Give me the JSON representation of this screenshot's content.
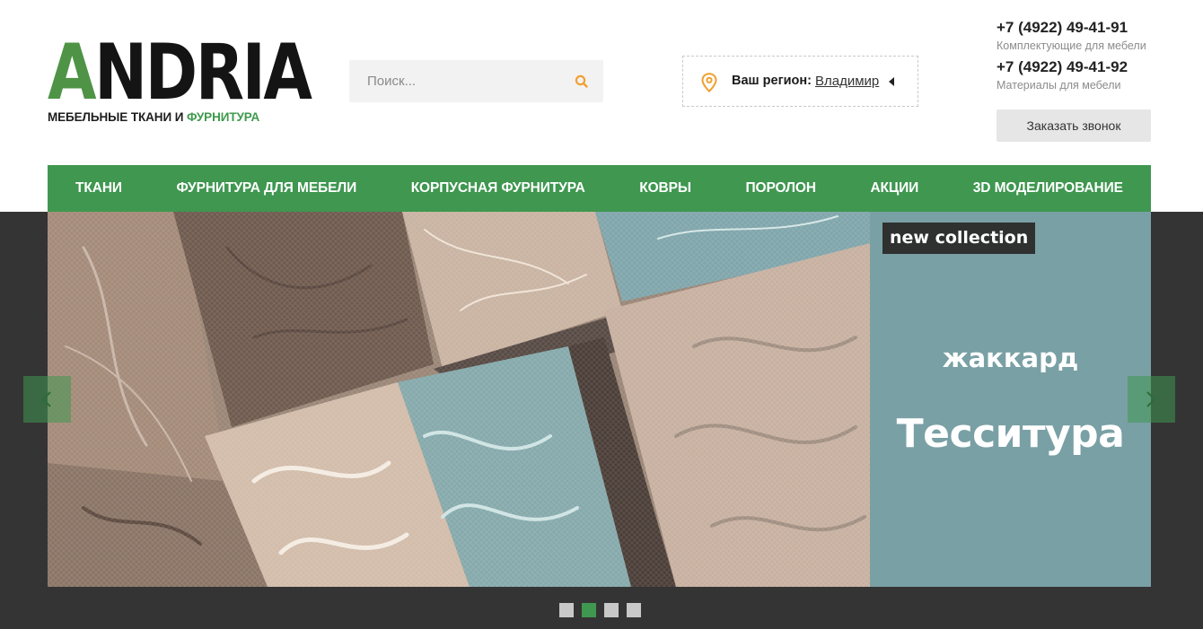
{
  "logo": {
    "first_letter": "A",
    "rest": "NDRIA",
    "tagline_main": "МЕБЕЛЬНЫЕ ТКАНИ И ",
    "tagline_accent": "ФУРНИТУРА"
  },
  "search": {
    "placeholder": "Поиск...",
    "icon": "search-icon"
  },
  "region": {
    "label": "Ваш регион:",
    "city": "Владимир",
    "icon": "map-pin-icon"
  },
  "contacts": [
    {
      "phone": "+7 (4922) 49-41-91",
      "note": "Комплектующие для мебели"
    },
    {
      "phone": "+7 (4922) 49-41-92",
      "note": "Материалы для мебели"
    }
  ],
  "callback_label": "Заказать звонок",
  "nav": [
    {
      "label": "ТКАНИ"
    },
    {
      "label": "ФУРНИТУРА ДЛЯ МЕБЕЛИ"
    },
    {
      "label": "КОРПУСНАЯ ФУРНИТУРА"
    },
    {
      "label": "КОВРЫ"
    },
    {
      "label": "ПОРОЛОН"
    },
    {
      "label": "АКЦИИ"
    },
    {
      "label": "3D МОДЕЛИРОВАНИЕ"
    }
  ],
  "slide": {
    "badge": "new collection",
    "subtitle": "жаккард",
    "title": "Тесситура"
  },
  "slider": {
    "total_slides": 4,
    "active_index": 1
  },
  "colors": {
    "brand_green": "#3f9750",
    "logo_green": "#4f9446",
    "panel_teal": "#79a0a5",
    "accent_orange": "#f0a030",
    "dark_band": "#343434"
  }
}
